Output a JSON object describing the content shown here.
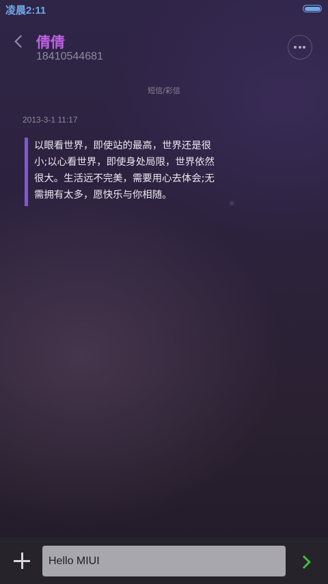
{
  "status_bar": {
    "time": "凌晨2:11",
    "battery_level": 1.0
  },
  "header": {
    "back_icon": "chevron-left-icon",
    "contact_name": "倩倩",
    "contact_number": "18410544681",
    "more_icon": "more-horizontal-icon"
  },
  "conversation": {
    "channel_label": "短信/彩信",
    "messages": [
      {
        "timestamp": "2013-3-1 11:17",
        "text": "以眼看世界，即使站的最高，世界还是很\n小;以心看世界，即使身处局限，世界依然\n很大。生活远不完美，需要用心去体会;无\n需拥有太多，愿快乐与你相随。"
      }
    ]
  },
  "composer": {
    "add_icon": "plus-icon",
    "input_value": "Hello MIUI",
    "send_icon": "chevron-right-icon"
  },
  "colors": {
    "accent": "#c061e6",
    "message_bar": "#7f58d4",
    "send": "#3ebe3c",
    "status": "#6fa9e8"
  }
}
